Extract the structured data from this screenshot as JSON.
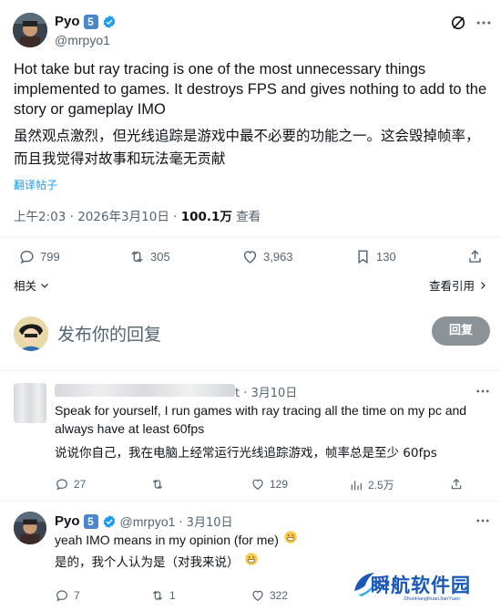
{
  "tweet": {
    "author_name": "Pyo",
    "badge": "5",
    "handle": "@mrpyo1",
    "text_en": "Hot take but ray tracing is one of the most unnecessary things implemented to games. It destroys FPS and gives nothing to add to the story or gameplay IMO",
    "text_cn": "虽然观点激烈，但光线追踪是游戏中最不必要的功能之一。这会毁掉帧率，而且我觉得对故事和玩法毫无贡献",
    "translate_link": "翻译帖子",
    "time": "上午2:03 · 2026年3月10日 · ",
    "views": "100.1万",
    "views_label": " 查看",
    "stats": {
      "replies": "799",
      "retweets": "305",
      "likes": "3,963",
      "bookmarks": "130"
    },
    "related_label": "相关",
    "quote_label": "查看引用"
  },
  "composer": {
    "placeholder": "发布你的回复",
    "button": "回复"
  },
  "reply1": {
    "time": "t · 3月10日",
    "text_en": "Speak for yourself, I run games with ray tracing all the time on my pc and always have at least 60fps",
    "text_cn": "说说你自己，我在电脑上经常运行光线追踪游戏，帧率总是至少 60fps",
    "stats": {
      "replies": "27",
      "likes": "129",
      "views": "2.5万"
    }
  },
  "reply2": {
    "author_name": "Pyo",
    "badge": "5",
    "handle": "@mrpyo1",
    "time": " · 3月10日",
    "text_en": "yeah IMO means in my opinion (for me)",
    "text_cn": "是的，我个人认为是（对我来说）",
    "stats": {
      "replies": "7",
      "retweets": "1",
      "likes": "322"
    }
  },
  "watermark": {
    "title": "瞬航软件园",
    "subtitle": "ShunHangRuanJianYuan"
  },
  "colors": {
    "accent": "#1d9bf0",
    "muted": "#536471",
    "verified": "#1d9bf0",
    "badge": "#4a86c8"
  }
}
